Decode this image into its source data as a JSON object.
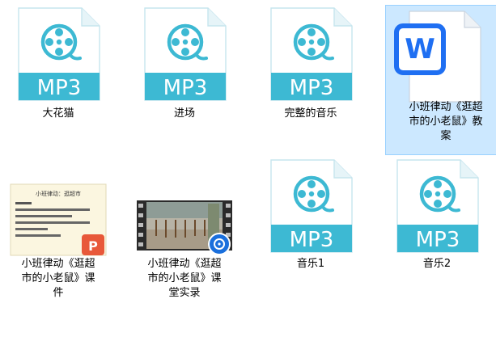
{
  "colors": {
    "mp3_accent": "#3db9d3",
    "word_blue": "#1f6ff2",
    "ppt_red": "#e8583a",
    "video_blue": "#1a6fdc",
    "selection_bg": "#cce8ff",
    "selection_border": "#99d1ff"
  },
  "files": [
    {
      "name": "大花猫",
      "type": "mp3",
      "badge": "MP3",
      "icon": "music-file-icon"
    },
    {
      "name": "进场",
      "type": "mp3",
      "badge": "MP3",
      "icon": "music-file-icon"
    },
    {
      "name": "完整的音乐",
      "type": "mp3",
      "badge": "MP3",
      "icon": "music-file-icon"
    },
    {
      "name_lines": [
        "小班律动《逛超",
        "市的小老鼠》教",
        "案"
      ],
      "type": "docx",
      "icon": "word-document-icon",
      "selected": true
    },
    {
      "name_lines": [
        "小班律动《逛超",
        "市的小老鼠》课",
        "件"
      ],
      "type": "pptx",
      "icon": "powerpoint-thumbnail-icon",
      "thumbnail_text": "小班律动：逛超市"
    },
    {
      "name_lines": [
        "小班律动《逛超",
        "市的小老鼠》课",
        "堂实录"
      ],
      "type": "video",
      "icon": "video-thumbnail-icon"
    },
    {
      "name": "音乐1",
      "type": "mp3",
      "badge": "MP3",
      "icon": "music-file-icon"
    },
    {
      "name": "音乐2",
      "type": "mp3",
      "badge": "MP3",
      "icon": "music-file-icon"
    }
  ]
}
